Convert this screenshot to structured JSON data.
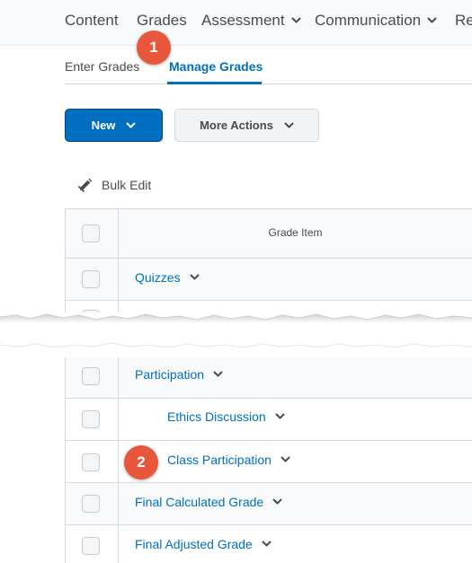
{
  "nav": {
    "items": [
      {
        "label": "Content",
        "has_menu": false
      },
      {
        "label": "Grades",
        "has_menu": false
      },
      {
        "label": "Assessment",
        "has_menu": true
      },
      {
        "label": "Communication",
        "has_menu": true
      },
      {
        "label": "Re",
        "has_menu": false
      }
    ]
  },
  "subnav": {
    "tabs": [
      {
        "label": "Enter Grades",
        "active": false
      },
      {
        "label": "Manage Grades",
        "active": true
      }
    ]
  },
  "toolbar": {
    "new_label": "New",
    "more_actions_label": "More Actions",
    "bulk_edit_label": "Bulk Edit"
  },
  "table": {
    "header": "Grade Item",
    "rows": [
      {
        "label": "Quizzes",
        "level": 0
      },
      {
        "label": "Participation",
        "level": 0
      },
      {
        "label": "Ethics Discussion",
        "level": 1
      },
      {
        "label": "Class Participation",
        "level": 1
      },
      {
        "label": "Final Calculated Grade",
        "level": 0
      },
      {
        "label": "Final Adjusted Grade",
        "level": 0
      }
    ]
  },
  "callouts": [
    {
      "label": "1",
      "target": "Grades"
    },
    {
      "label": "2",
      "target": "Class Participation"
    }
  ],
  "colors": {
    "accent": "#006fbf",
    "callout": "#e8573b",
    "border": "#d3d9e3"
  }
}
